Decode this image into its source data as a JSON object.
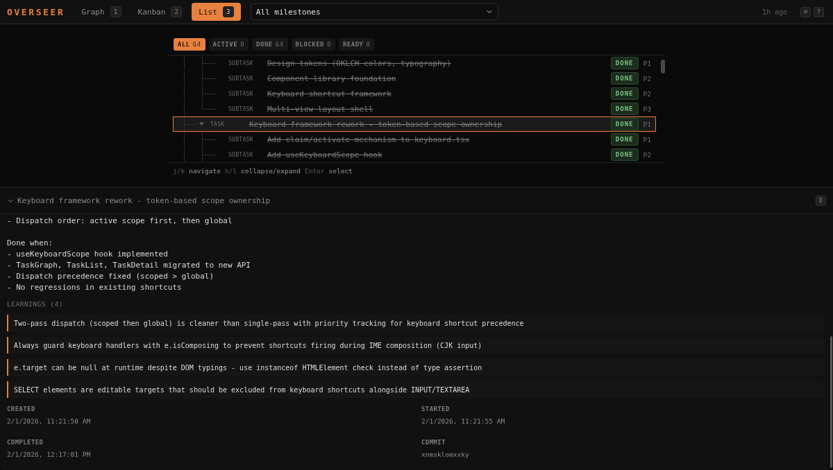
{
  "app": {
    "logo": "OVERSEER"
  },
  "view_tabs": [
    {
      "label": "Graph",
      "key": "1",
      "selected": false
    },
    {
      "label": "Kanban",
      "key": "2",
      "selected": false
    },
    {
      "label": "List",
      "key": "3",
      "selected": true
    }
  ],
  "milestone_select": {
    "value": "All milestones"
  },
  "header_status": {
    "updated": "1h ago",
    "keys": [
      "⌘",
      "?"
    ]
  },
  "filters": [
    {
      "label": "ALL",
      "count": "64",
      "selected": true
    },
    {
      "label": "ACTIVE",
      "count": "0",
      "selected": false
    },
    {
      "label": "DONE",
      "count": "64",
      "selected": false
    },
    {
      "label": "BLOCKED",
      "count": "0",
      "selected": false
    },
    {
      "label": "READY",
      "count": "0",
      "selected": false
    }
  ],
  "tree": [
    {
      "children": [
        {
          "type": "SUBTASK",
          "title": "Design tokens (OKLCH colors, typography)",
          "status": "DONE",
          "priority": "P1",
          "completed": true,
          "selected": false
        },
        {
          "type": "SUBTASK",
          "title": "Component library foundation",
          "status": "DONE",
          "priority": "P2",
          "completed": true,
          "selected": false
        },
        {
          "type": "SUBTASK",
          "title": "Keyboard shortcut framework",
          "status": "DONE",
          "priority": "P2",
          "completed": true,
          "selected": false
        },
        {
          "type": "SUBTASK",
          "title": "Multi-view layout shell",
          "status": "DONE",
          "priority": "P3",
          "completed": true,
          "selected": false
        }
      ]
    },
    {
      "type": "TASK",
      "title": "Keyboard framework rework - token-based scope ownership",
      "status": "DONE",
      "priority": "P1",
      "completed": true,
      "selected": true,
      "expanded": true,
      "children": [
        {
          "type": "SUBTASK",
          "title": "Add claim/activate mechanism to keyboard.tsx",
          "status": "DONE",
          "priority": "P1",
          "completed": true,
          "selected": false
        },
        {
          "type": "SUBTASK",
          "title": "Add useKeyboardScope hook",
          "status": "DONE",
          "priority": "P2",
          "completed": true,
          "selected": false
        }
      ]
    }
  ],
  "hints": [
    {
      "key": "j/k",
      "action": "navigate"
    },
    {
      "key": "h/l",
      "action": "collapse/expand"
    },
    {
      "key": "Enter",
      "action": "select"
    }
  ],
  "detail": {
    "title": "Keyboard framework rework - token-based scope ownership",
    "expanded": true,
    "shortcut": "D",
    "description": [
      {
        "lines": [
          "- Dispatch order: active scope first, then global"
        ]
      },
      {
        "lines": [
          "Done when:",
          "- useKeyboardScope hook implemented",
          "- TaskGraph, TaskList, TaskDetail migrated to new API",
          "- Dispatch precedence fixed (scoped > global)",
          "- No regressions in existing shortcuts"
        ]
      }
    ],
    "learnings": {
      "heading": "LEARNINGS (4)",
      "items": [
        "Two-pass dispatch (scoped then global) is cleaner than single-pass with priority tracking for keyboard shortcut precedence",
        "Always guard keyboard handlers with e.isComposing to prevent shortcuts firing during IME composition (CJK input)",
        "e.target can be null at runtime despite DOM typings - use instanceof HTMLElement check instead of type assertion",
        "SELECT elements are editable targets that should be excluded from keyboard shortcuts alongside INPUT/TEXTAREA"
      ]
    },
    "meta": [
      {
        "label": "CREATED",
        "value": "2/1/2026, 11:21:50 AM"
      },
      {
        "label": "STARTED",
        "value": "2/1/2026, 11:21:55 AM"
      },
      {
        "label": "COMPLETED",
        "value": "2/1/2026, 12:17:01 PM"
      },
      {
        "label": "COMMIT",
        "value": "xnmsklomxxky"
      }
    ]
  }
}
